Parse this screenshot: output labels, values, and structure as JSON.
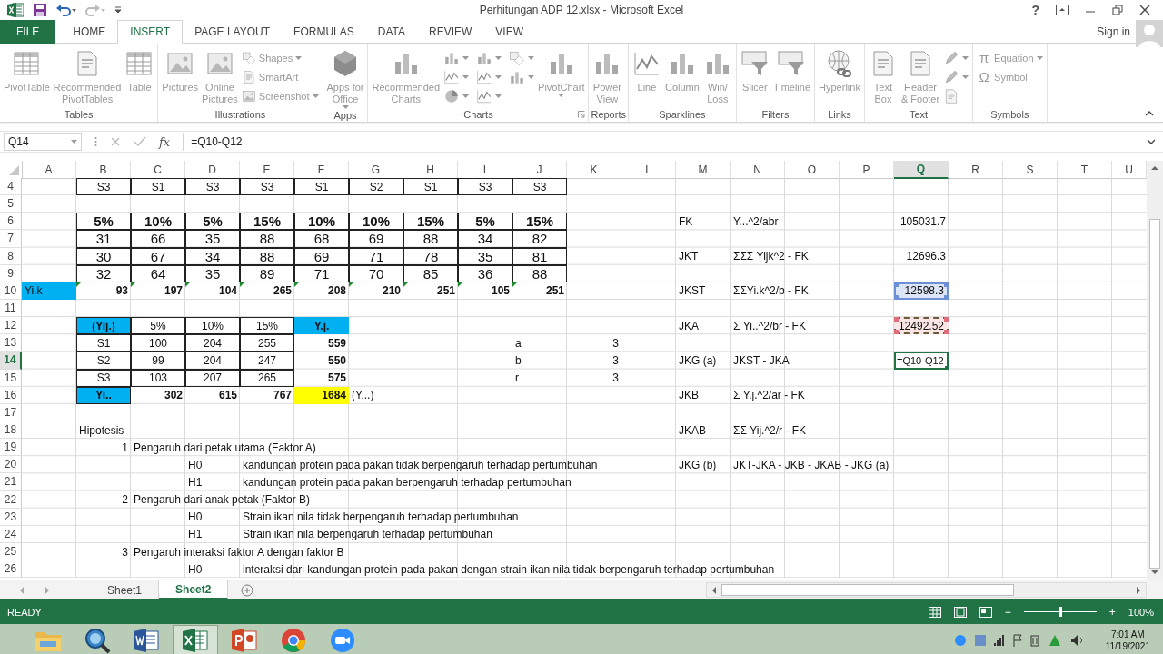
{
  "window": {
    "title": "Perhitungan ADP 12.xlsx - Microsoft Excel",
    "help": "?"
  },
  "tabs": [
    {
      "label": "FILE",
      "kind": "file",
      "selected": false
    },
    {
      "label": "HOME",
      "kind": "tab",
      "selected": false
    },
    {
      "label": "INSERT",
      "kind": "tab",
      "selected": true
    },
    {
      "label": "PAGE LAYOUT",
      "kind": "tab",
      "selected": false
    },
    {
      "label": "FORMULAS",
      "kind": "tab",
      "selected": false
    },
    {
      "label": "DATA",
      "kind": "tab",
      "selected": false
    },
    {
      "label": "REVIEW",
      "kind": "tab",
      "selected": false
    },
    {
      "label": "VIEW",
      "kind": "tab",
      "selected": false
    }
  ],
  "account": {
    "label": "Sign in"
  },
  "ribbon": {
    "disabled": true,
    "groups": [
      {
        "label": "Tables",
        "items": [
          {
            "label": "PivotTable",
            "kind": "large"
          },
          {
            "label": "Recommended\nPivotTables",
            "kind": "large"
          },
          {
            "label": "Table",
            "kind": "large"
          }
        ]
      },
      {
        "label": "Illustrations",
        "items": [
          {
            "label": "Pictures",
            "kind": "large"
          },
          {
            "label": "Online\nPictures",
            "kind": "large"
          },
          {
            "label": "Shapes",
            "kind": "small",
            "dropdown": true
          },
          {
            "label": "SmartArt",
            "kind": "small"
          },
          {
            "label": "Screenshot",
            "kind": "small",
            "dropdown": true
          }
        ]
      },
      {
        "label": "Apps",
        "items": [
          {
            "label": "Apps for\nOffice",
            "kind": "large",
            "dropdown": true
          }
        ]
      },
      {
        "label": "Charts",
        "launcher": true,
        "items": [
          {
            "label": "Recommended\nCharts",
            "kind": "large"
          },
          {
            "kind": "icon",
            "dropdown": true
          },
          {
            "kind": "icon",
            "dropdown": true
          },
          {
            "kind": "icon",
            "dropdown": true
          },
          {
            "kind": "icon",
            "dropdown": true
          },
          {
            "kind": "icon",
            "dropdown": true
          },
          {
            "kind": "icon",
            "dropdown": true
          },
          {
            "kind": "icon",
            "dropdown": true
          },
          {
            "kind": "icon",
            "dropdown": true
          },
          {
            "label": "PivotChart",
            "kind": "large",
            "dropdown": true
          }
        ]
      },
      {
        "label": "Reports",
        "items": [
          {
            "label": "Power\nView",
            "kind": "large"
          }
        ]
      },
      {
        "label": "Sparklines",
        "items": [
          {
            "label": "Line",
            "kind": "large"
          },
          {
            "label": "Column",
            "kind": "large"
          },
          {
            "label": "Win/\nLoss",
            "kind": "large"
          }
        ]
      },
      {
        "label": "Filters",
        "items": [
          {
            "label": "Slicer",
            "kind": "large"
          },
          {
            "label": "Timeline",
            "kind": "large"
          }
        ]
      },
      {
        "label": "Links",
        "items": [
          {
            "label": "Hyperlink",
            "kind": "large"
          }
        ]
      },
      {
        "label": "Text",
        "items": [
          {
            "label": "Text\nBox",
            "kind": "large"
          },
          {
            "label": "Header\n& Footer",
            "kind": "large"
          },
          {
            "kind": "icon",
            "dropdown": true
          },
          {
            "kind": "icon",
            "dropdown": true
          },
          {
            "kind": "icon"
          }
        ]
      },
      {
        "label": "Symbols",
        "items": [
          {
            "label": "Equation",
            "glyph": "π",
            "kind": "small",
            "dropdown": true
          },
          {
            "label": "Symbol",
            "glyph": "Ω",
            "kind": "small"
          }
        ]
      }
    ]
  },
  "formula_bar": {
    "name_box": "Q14",
    "fx": "fx",
    "formula": "=Q10-Q12"
  },
  "columns": [
    {
      "label": "A",
      "selected": false
    },
    {
      "label": "B",
      "selected": false
    },
    {
      "label": "C",
      "selected": false
    },
    {
      "label": "D",
      "selected": false
    },
    {
      "label": "E",
      "selected": false
    },
    {
      "label": "F",
      "selected": false
    },
    {
      "label": "G",
      "selected": false
    },
    {
      "label": "H",
      "selected": false
    },
    {
      "label": "I",
      "selected": false
    },
    {
      "label": "J",
      "selected": false
    },
    {
      "label": "K",
      "selected": false
    },
    {
      "label": "L",
      "selected": false
    },
    {
      "label": "M",
      "selected": false
    },
    {
      "label": "N",
      "selected": false
    },
    {
      "label": "O",
      "selected": false
    },
    {
      "label": "P",
      "selected": false
    },
    {
      "label": "Q",
      "selected": true
    },
    {
      "label": "R",
      "selected": false
    },
    {
      "label": "S",
      "selected": false
    },
    {
      "label": "T",
      "selected": false
    },
    {
      "label": "U",
      "selected": false
    }
  ],
  "rows": [
    {
      "label": "4",
      "selected": false,
      "cells": {
        "B": {
          "text": "S3",
          "kind": "center",
          "bordered": true
        },
        "C": {
          "text": "S1",
          "kind": "center",
          "bordered": true
        },
        "D": {
          "text": "S3",
          "kind": "center",
          "bordered": true
        },
        "E": {
          "text": "S3",
          "kind": "center",
          "bordered": true
        },
        "F": {
          "text": "S1",
          "kind": "center",
          "bordered": true
        },
        "G": {
          "text": "S2",
          "kind": "center",
          "bordered": true
        },
        "H": {
          "text": "S1",
          "kind": "center",
          "bordered": true
        },
        "I": {
          "text": "S3",
          "kind": "center",
          "bordered": true
        },
        "J": {
          "text": "S3",
          "kind": "center",
          "bordered": true
        }
      }
    },
    {
      "label": "5",
      "selected": false
    },
    {
      "label": "6",
      "selected": false,
      "cells": {
        "B": {
          "text": "5%",
          "kind": "center",
          "bold": true,
          "large": true,
          "bordered": true
        },
        "C": {
          "text": "10%",
          "kind": "center",
          "bold": true,
          "large": true,
          "bordered": true
        },
        "D": {
          "text": "5%",
          "kind": "center",
          "bold": true,
          "large": true,
          "bordered": true
        },
        "E": {
          "text": "15%",
          "kind": "center",
          "bold": true,
          "large": true,
          "bordered": true
        },
        "F": {
          "text": "10%",
          "kind": "center",
          "bold": true,
          "large": true,
          "bordered": true
        },
        "G": {
          "text": "10%",
          "kind": "center",
          "bold": true,
          "large": true,
          "bordered": true
        },
        "H": {
          "text": "15%",
          "kind": "center",
          "bold": true,
          "large": true,
          "bordered": true
        },
        "I": {
          "text": "5%",
          "kind": "center",
          "bold": true,
          "large": true,
          "bordered": true
        },
        "J": {
          "text": "15%",
          "kind": "center",
          "bold": true,
          "large": true,
          "bordered": true
        },
        "M": {
          "text": "FK",
          "kind": "left"
        },
        "N": {
          "text": "Y...^2/abr",
          "kind": "left"
        },
        "Q": {
          "text": "105031.7",
          "kind": "right"
        }
      }
    },
    {
      "label": "7",
      "selected": false,
      "cells": {
        "B": {
          "text": "31",
          "kind": "center",
          "large": true,
          "bordered": true
        },
        "C": {
          "text": "66",
          "kind": "center",
          "large": true,
          "bordered": true
        },
        "D": {
          "text": "35",
          "kind": "center",
          "large": true,
          "bordered": true
        },
        "E": {
          "text": "88",
          "kind": "center",
          "large": true,
          "bordered": true
        },
        "F": {
          "text": "68",
          "kind": "center",
          "large": true,
          "bordered": true
        },
        "G": {
          "text": "69",
          "kind": "center",
          "large": true,
          "bordered": true
        },
        "H": {
          "text": "88",
          "kind": "center",
          "large": true,
          "bordered": true
        },
        "I": {
          "text": "34",
          "kind": "center",
          "large": true,
          "bordered": true
        },
        "J": {
          "text": "82",
          "kind": "center",
          "large": true,
          "bordered": true
        }
      }
    },
    {
      "label": "8",
      "selected": false,
      "cells": {
        "B": {
          "text": "30",
          "kind": "center",
          "large": true,
          "bordered": true
        },
        "C": {
          "text": "67",
          "kind": "center",
          "large": true,
          "bordered": true
        },
        "D": {
          "text": "34",
          "kind": "center",
          "large": true,
          "bordered": true
        },
        "E": {
          "text": "88",
          "kind": "center",
          "large": true,
          "bordered": true
        },
        "F": {
          "text": "69",
          "kind": "center",
          "large": true,
          "bordered": true
        },
        "G": {
          "text": "71",
          "kind": "center",
          "large": true,
          "bordered": true
        },
        "H": {
          "text": "78",
          "kind": "center",
          "large": true,
          "bordered": true
        },
        "I": {
          "text": "35",
          "kind": "center",
          "large": true,
          "bordered": true
        },
        "J": {
          "text": "81",
          "kind": "center",
          "large": true,
          "bordered": true
        },
        "M": {
          "text": "JKT",
          "kind": "left"
        },
        "N": {
          "text": "ΣΣΣ Yijk^2 - FK",
          "kind": "left"
        },
        "Q": {
          "text": "12696.3",
          "kind": "right"
        }
      }
    },
    {
      "label": "9",
      "selected": false,
      "cells": {
        "B": {
          "text": "32",
          "kind": "center",
          "large": true,
          "bordered": true
        },
        "C": {
          "text": "64",
          "kind": "center",
          "large": true,
          "bordered": true
        },
        "D": {
          "text": "35",
          "kind": "center",
          "large": true,
          "bordered": true
        },
        "E": {
          "text": "89",
          "kind": "center",
          "large": true,
          "bordered": true
        },
        "F": {
          "text": "71",
          "kind": "center",
          "large": true,
          "bordered": true
        },
        "G": {
          "text": "70",
          "kind": "center",
          "large": true,
          "bordered": true
        },
        "H": {
          "text": "85",
          "kind": "center",
          "large": true,
          "bordered": true
        },
        "I": {
          "text": "36",
          "kind": "center",
          "large": true,
          "bordered": true
        },
        "J": {
          "text": "88",
          "kind": "center",
          "large": true,
          "bordered": true
        }
      }
    },
    {
      "label": "10",
      "selected": false,
      "cells": {
        "A": {
          "text": "Yi.k",
          "kind": "left",
          "color": "#00b0f0"
        },
        "B": {
          "text": "93",
          "kind": "right",
          "bold": true,
          "flag": true
        },
        "C": {
          "text": "197",
          "kind": "right",
          "bold": true,
          "flag": true
        },
        "D": {
          "text": "104",
          "kind": "right",
          "bold": true,
          "flag": true
        },
        "E": {
          "text": "265",
          "kind": "right",
          "bold": true,
          "flag": true
        },
        "F": {
          "text": "208",
          "kind": "right",
          "bold": true,
          "flag": true
        },
        "G": {
          "text": "210",
          "kind": "right",
          "bold": true,
          "flag": true
        },
        "H": {
          "text": "251",
          "kind": "right",
          "bold": true,
          "flag": true
        },
        "I": {
          "text": "105",
          "kind": "right",
          "bold": true,
          "flag": true
        },
        "J": {
          "text": "251",
          "kind": "right",
          "bold": true,
          "flag": true
        },
        "M": {
          "text": "JKST",
          "kind": "left"
        },
        "N": {
          "text": "ΣΣYi.k^2/b - FK",
          "kind": "left"
        },
        "Q": {
          "text": "12598.3",
          "kind": "right",
          "referenced": true
        }
      }
    },
    {
      "label": "11",
      "selected": false
    },
    {
      "label": "12",
      "selected": false,
      "cells": {
        "B": {
          "text": "(Yij.)",
          "kind": "center",
          "bold": true,
          "color": "#00b0f0",
          "bordered": true
        },
        "C": {
          "text": "5%",
          "kind": "center",
          "bordered": true
        },
        "D": {
          "text": "10%",
          "kind": "center",
          "bordered": true
        },
        "E": {
          "text": "15%",
          "kind": "center",
          "bordered": true
        },
        "F": {
          "text": "Y.j.",
          "kind": "center",
          "bold": true,
          "color": "#00b0f0"
        },
        "M": {
          "text": "JKA",
          "kind": "left"
        },
        "N": {
          "text": "Σ Yi..^2/br - FK",
          "kind": "left"
        },
        "Q": {
          "text": "12492.52",
          "kind": "right",
          "copied": true
        }
      }
    },
    {
      "label": "13",
      "selected": false,
      "cells": {
        "B": {
          "text": "S1",
          "kind": "center",
          "bordered": true
        },
        "C": {
          "text": "100",
          "kind": "center",
          "bordered": true
        },
        "D": {
          "text": "204",
          "kind": "center",
          "bordered": true
        },
        "E": {
          "text": "255",
          "kind": "center",
          "bordered": true
        },
        "F": {
          "text": "559",
          "kind": "right",
          "bold": true
        },
        "J": {
          "text": "a",
          "kind": "left"
        },
        "K": {
          "text": "3",
          "kind": "right"
        }
      }
    },
    {
      "label": "14",
      "selected": true,
      "cells": {
        "B": {
          "text": "S2",
          "kind": "center",
          "bordered": true
        },
        "C": {
          "text": "99",
          "kind": "center",
          "bordered": true
        },
        "D": {
          "text": "204",
          "kind": "center",
          "bordered": true
        },
        "E": {
          "text": "247",
          "kind": "center",
          "bordered": true
        },
        "F": {
          "text": "550",
          "kind": "right",
          "bold": true
        },
        "J": {
          "text": "b",
          "kind": "left"
        },
        "K": {
          "text": "3",
          "kind": "right"
        },
        "M": {
          "text": "JKG (a)",
          "kind": "left"
        },
        "N": {
          "text": "JKST - JKA",
          "kind": "left"
        },
        "Q": {
          "text": "=Q10-Q12",
          "kind": "left",
          "editing": true
        }
      }
    },
    {
      "label": "15",
      "selected": false,
      "cells": {
        "B": {
          "text": "S3",
          "kind": "center",
          "bordered": true
        },
        "C": {
          "text": "103",
          "kind": "center",
          "bordered": true
        },
        "D": {
          "text": "207",
          "kind": "center",
          "bordered": true
        },
        "E": {
          "text": "265",
          "kind": "center",
          "bordered": true
        },
        "F": {
          "text": "575",
          "kind": "right",
          "bold": true
        },
        "J": {
          "text": "r",
          "kind": "left"
        },
        "K": {
          "text": "3",
          "kind": "right"
        }
      }
    },
    {
      "label": "16",
      "selected": false,
      "cells": {
        "B": {
          "text": "Yi..",
          "kind": "center",
          "bold": true,
          "color": "#00b0f0",
          "bordered": true
        },
        "C": {
          "text": "302",
          "kind": "right",
          "bold": true
        },
        "D": {
          "text": "615",
          "kind": "right",
          "bold": true
        },
        "E": {
          "text": "767",
          "kind": "right",
          "bold": true
        },
        "F": {
          "text": "1684",
          "kind": "right",
          "bold": true,
          "color": "#ffff00"
        },
        "G": {
          "text": "(Y...)",
          "kind": "left"
        },
        "M": {
          "text": "JKB",
          "kind": "left"
        },
        "N": {
          "text": "Σ Y.j.^2/ar - FK",
          "kind": "left"
        }
      }
    },
    {
      "label": "17",
      "selected": false
    },
    {
      "label": "18",
      "selected": false,
      "cells": {
        "B": {
          "text": "Hipotesis",
          "kind": "left"
        },
        "M": {
          "text": "JKAB",
          "kind": "left"
        },
        "N": {
          "text": "ΣΣ Yij.^2/r - FK",
          "kind": "left"
        }
      }
    },
    {
      "label": "19",
      "selected": false,
      "cells": {
        "B": {
          "text": "1",
          "kind": "right"
        },
        "C": {
          "text": "Pengaruh dari petak utama (Faktor A)",
          "kind": "left"
        }
      }
    },
    {
      "label": "20",
      "selected": false,
      "cells": {
        "D": {
          "text": "H0",
          "kind": "left"
        },
        "E": {
          "text": "kandungan protein pada pakan tidak berpengaruh terhadap pertumbuhan",
          "kind": "left"
        },
        "M": {
          "text": "JKG (b)",
          "kind": "left"
        },
        "N": {
          "text": "JKT-JKA - JKB - JKAB - JKG (a)",
          "kind": "left"
        }
      }
    },
    {
      "label": "21",
      "selected": false,
      "cells": {
        "D": {
          "text": "H1",
          "kind": "left"
        },
        "E": {
          "text": "kandungan protein pada pakan berpengaruh terhadap pertumbuhan",
          "kind": "left"
        }
      }
    },
    {
      "label": "22",
      "selected": false,
      "cells": {
        "B": {
          "text": "2",
          "kind": "right"
        },
        "C": {
          "text": "Pengaruh dari anak petak (Faktor B)",
          "kind": "left"
        }
      }
    },
    {
      "label": "23",
      "selected": false,
      "cells": {
        "D": {
          "text": "H0",
          "kind": "left"
        },
        "E": {
          "text": "Strain ikan nila tidak berpengaruh terhadap pertumbuhan",
          "kind": "left"
        }
      }
    },
    {
      "label": "24",
      "selected": false,
      "cells": {
        "D": {
          "text": "H1",
          "kind": "left"
        },
        "E": {
          "text": "Strain ikan nila berpengaruh terhadap pertumbuhan",
          "kind": "left"
        }
      }
    },
    {
      "label": "25",
      "selected": false,
      "cells": {
        "B": {
          "text": "3",
          "kind": "right"
        },
        "C": {
          "text": "Pengaruh interaksi faktor A dengan faktor B",
          "kind": "left"
        }
      }
    },
    {
      "label": "26",
      "selected": false,
      "cells": {
        "D": {
          "text": "H0",
          "kind": "left"
        },
        "E": {
          "text": "interaksi dari kandungan protein pada pakan dengan strain ikan nila tidak berpengaruh terhadap pertumbuhan",
          "kind": "left"
        }
      }
    }
  ],
  "sheets": [
    {
      "label": "Sheet1",
      "selected": false
    },
    {
      "label": "Sheet2",
      "selected": true
    }
  ],
  "status_bar": {
    "mode": "READY",
    "zoom": {
      "zoom_out": "−",
      "level": 0.5,
      "zoom_in": "+",
      "reading": "100%"
    }
  },
  "taskbar": {
    "apps": [
      {
        "selected": false
      },
      {
        "selected": false
      },
      {
        "selected": false
      },
      {
        "selected": true
      },
      {
        "selected": false
      },
      {
        "selected": false
      },
      {
        "selected": false
      }
    ],
    "time": "7:01 AM",
    "date": "11/19/2021"
  }
}
